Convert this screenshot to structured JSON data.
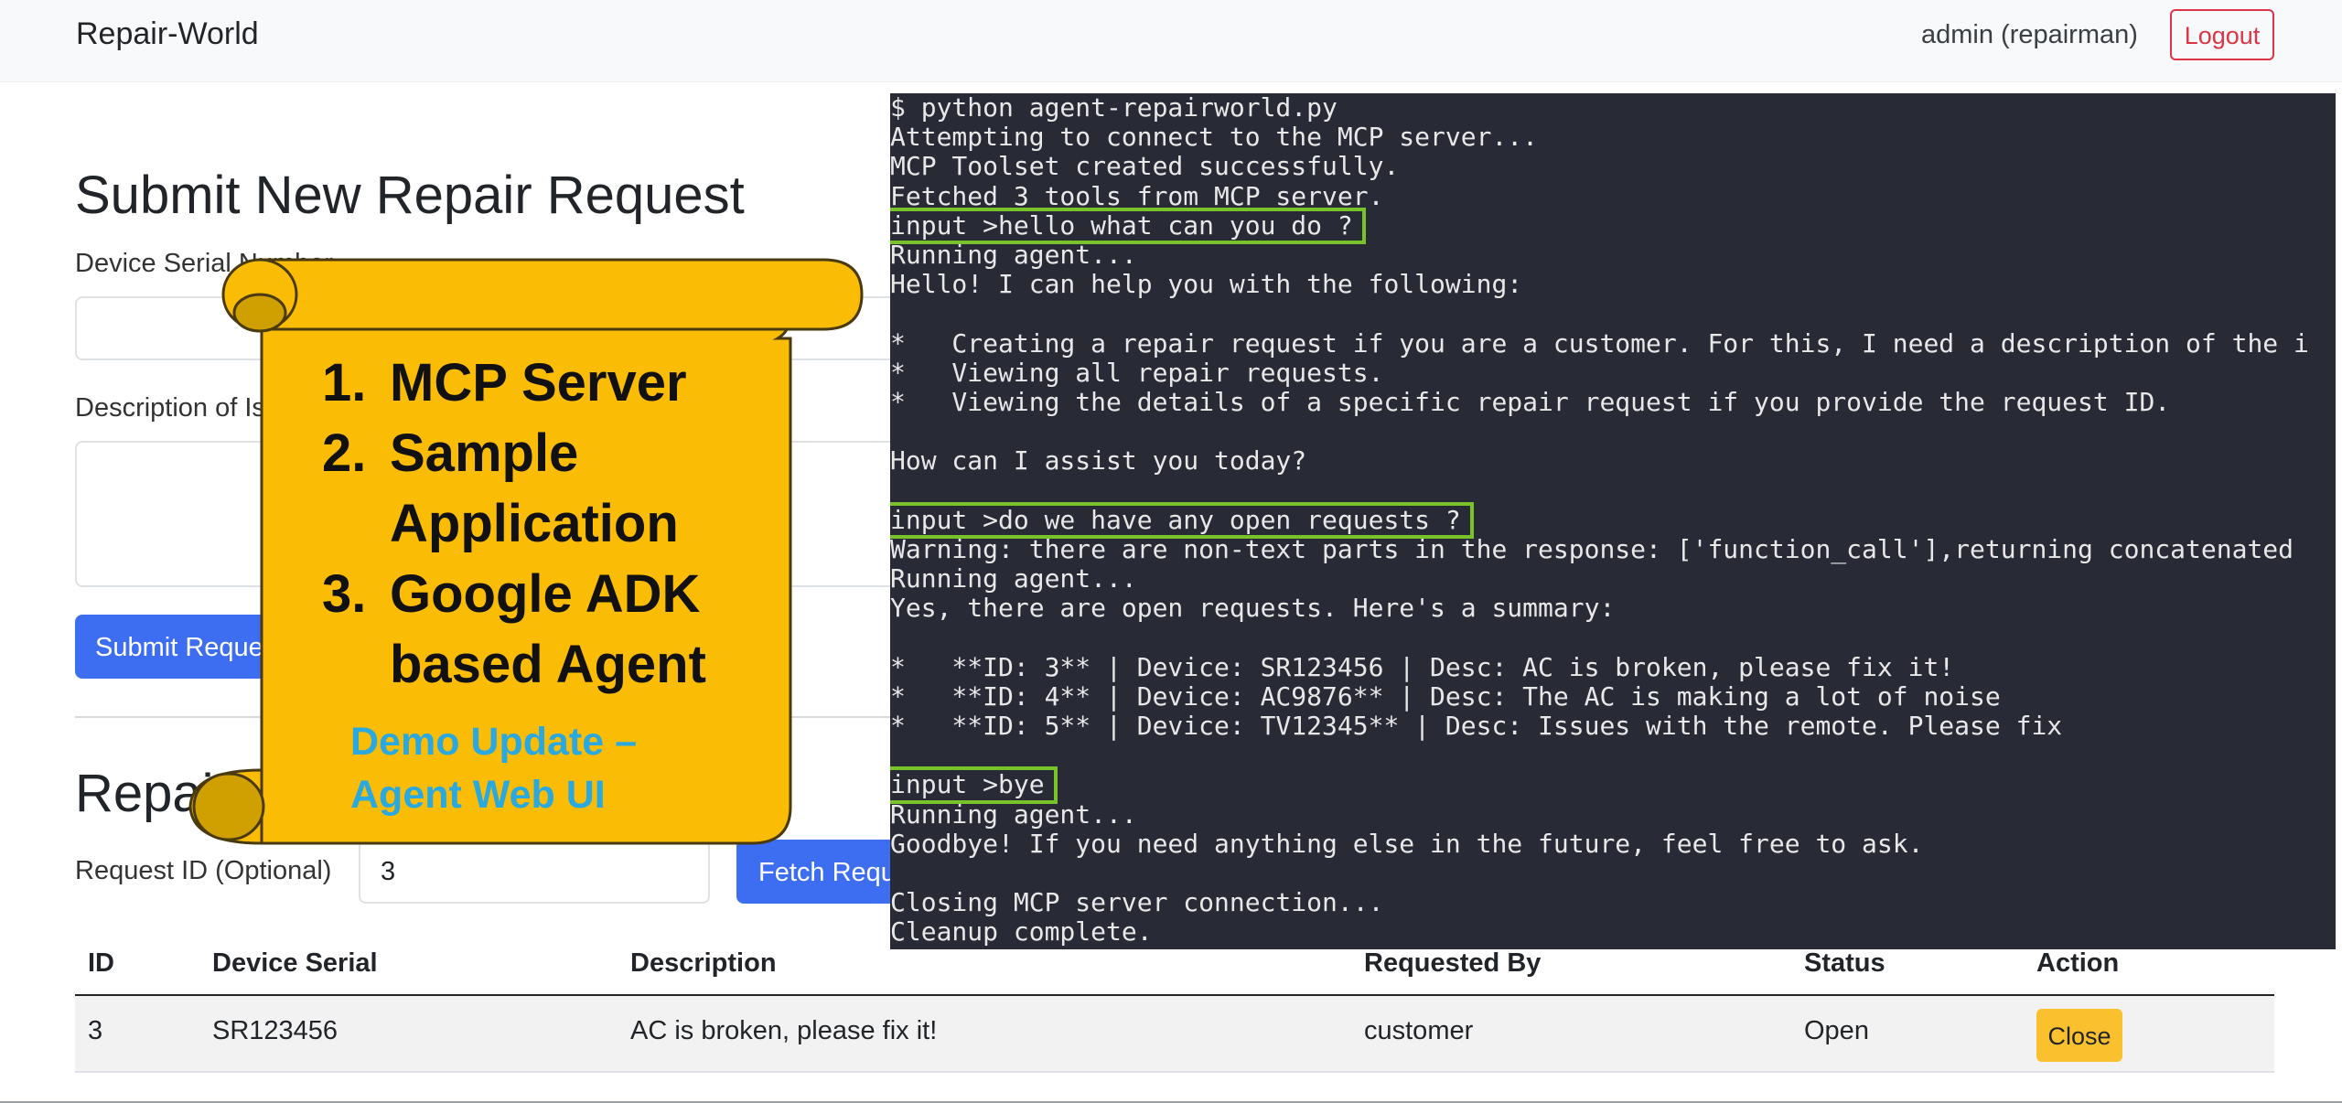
{
  "navbar": {
    "brand": "Repair-World",
    "user": "admin (repairman)",
    "logout_label": "Logout"
  },
  "submit_form": {
    "heading": "Submit New Repair Request",
    "serial_label": "Device Serial Number",
    "serial_value": "",
    "description_label": "Description of Issue",
    "description_value": "",
    "submit_label": "Submit Request"
  },
  "requests": {
    "heading": "Repair Requests",
    "request_id_label": "Request ID (Optional)",
    "request_id_value": "3",
    "fetch_label": "Fetch Request",
    "columns": [
      "ID",
      "Device Serial",
      "Description",
      "Requested By",
      "Status",
      "Action"
    ],
    "rows": [
      {
        "id": "3",
        "device_serial": "SR123456",
        "description": "AC is broken, please fix it!",
        "requested_by": "customer",
        "status": "Open",
        "action": "Close"
      }
    ]
  },
  "scroll_overlay": {
    "items": [
      {
        "num": "1.",
        "text": "MCP Server"
      },
      {
        "num": "2.",
        "text": "Sample Application"
      },
      {
        "num": "3.",
        "text": "Google ADK based Agent"
      }
    ],
    "demo_note": "Demo Update – Agent Web UI",
    "colors": {
      "parchment": "#fbbc05",
      "curl": "#cfa000",
      "outline": "#4a3a10",
      "demo_text": "#29a9e0"
    }
  },
  "terminal": {
    "background": "#282a36",
    "highlight_color": "#79c32a",
    "lines": [
      "$ python agent-repairworld.py",
      "Attempting to connect to the MCP server...",
      "MCP Toolset created successfully.",
      "Fetched 3 tools from MCP server.",
      "input >hello what can you do ?",
      "Running agent...",
      "Hello! I can help you with the following:",
      "",
      "*   Creating a repair request if you are a customer. For this, I need a description of the i",
      "*   Viewing all repair requests.",
      "*   Viewing the details of a specific repair request if you provide the request ID.",
      "",
      "How can I assist you today?",
      "",
      "input >do we have any open requests ?",
      "Warning: there are non-text parts in the response: ['function_call'],returning concatenated",
      "Running agent...",
      "Yes, there are open requests. Here's a summary:",
      "",
      "*   **ID: 3** | Device: SR123456 | Desc: AC is broken, please fix it!",
      "*   **ID: 4** | Device: AC9876** | Desc: The AC is making a lot of noise",
      "*   **ID: 5** | Device: TV12345** | Desc: Issues with the remote. Please fix",
      "",
      "input >bye",
      "Running agent...",
      "Goodbye! If you need anything else in the future, feel free to ask.",
      "",
      "Closing MCP server connection...",
      "Cleanup complete."
    ],
    "highlighted_line_indexes": [
      4,
      14,
      23
    ]
  }
}
